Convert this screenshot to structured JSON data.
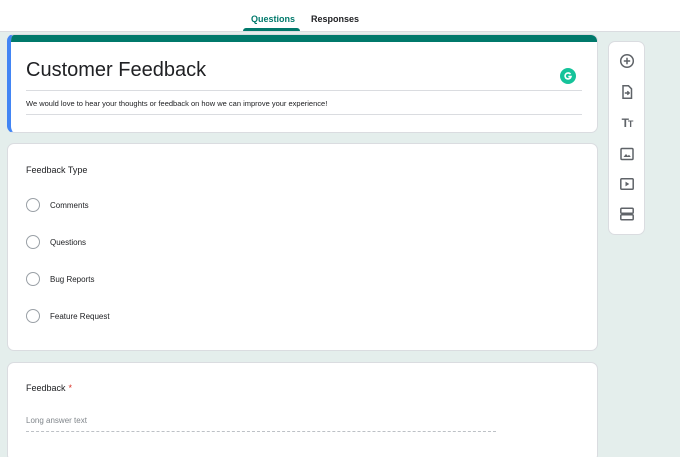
{
  "tabs": [
    {
      "label": "Questions",
      "active": true
    },
    {
      "label": "Responses",
      "active": false
    }
  ],
  "form": {
    "title": "Customer Feedback",
    "description": "We would love to hear your thoughts or feedback on how we can improve your experience!"
  },
  "questions": [
    {
      "title": "Feedback Type",
      "type": "multiple-choice",
      "options": [
        "Comments",
        "Questions",
        "Bug Reports",
        "Feature Request"
      ]
    },
    {
      "title": "Feedback",
      "required": true,
      "required_mark": "*",
      "type": "paragraph",
      "placeholder": "Long answer text"
    }
  ],
  "sidebar": {
    "icons": [
      "add-question-icon",
      "import-questions-icon",
      "add-title-icon",
      "add-image-icon",
      "add-video-icon",
      "add-section-icon"
    ]
  },
  "colors": {
    "accent": "#00796b",
    "left_border": "#4285f4",
    "background": "#e4eeec",
    "required": "#d93025"
  }
}
